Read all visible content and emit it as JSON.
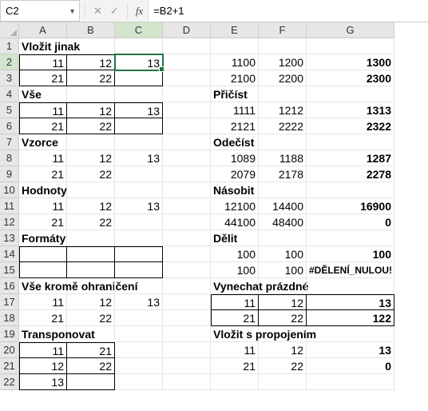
{
  "formula_bar": {
    "cell_ref": "C2",
    "formula": "=B2+1",
    "fx_label": "fx",
    "cancel_icon": "✕",
    "confirm_icon": "✓"
  },
  "columns": [
    "A",
    "B",
    "C",
    "D",
    "E",
    "F",
    "G"
  ],
  "rows": [
    "1",
    "2",
    "3",
    "4",
    "5",
    "6",
    "7",
    "8",
    "9",
    "10",
    "11",
    "12",
    "13",
    "14",
    "15",
    "16",
    "17",
    "18",
    "19",
    "20",
    "21",
    "22"
  ],
  "active_cell": "C2",
  "headers": {
    "r1_A": "Vložit jinak",
    "r4_A": "Vše",
    "r7_A": "Vzorce",
    "r10_A": "Hodnoty",
    "r13_A": "Formáty",
    "r16_A": "Vše kromě ohraničení",
    "r19_A": "Transponovat",
    "r4_E": "Přičíst",
    "r7_E": "Odečíst",
    "r10_E": "Násobit",
    "r13_E": "Dělit",
    "r16_E": "Vynechat prázdné",
    "r19_E": "Vložit s propojením"
  },
  "cells": {
    "A2": "11",
    "B2": "12",
    "C2": "13",
    "E2": "1100",
    "F2": "1200",
    "G2": "1300",
    "A3": "21",
    "B3": "22",
    "E3": "2100",
    "F3": "2200",
    "G3": "2300",
    "A5": "11",
    "B5": "12",
    "C5": "13",
    "E5": "1111",
    "F5": "1212",
    "G5": "1313",
    "A6": "21",
    "B6": "22",
    "E6": "2121",
    "F6": "2222",
    "G6": "2322",
    "A8": "11",
    "B8": "12",
    "C8": "13",
    "E8": "1089",
    "F8": "1188",
    "G8": "1287",
    "A9": "21",
    "B9": "22",
    "E9": "2079",
    "F9": "2178",
    "G9": "2278",
    "A11": "11",
    "B11": "12",
    "C11": "13",
    "E11": "12100",
    "F11": "14400",
    "G11": "16900",
    "A12": "21",
    "B12": "22",
    "E12": "44100",
    "F12": "48400",
    "G12": "0",
    "E14": "100",
    "F14": "100",
    "G14": "100",
    "E15": "100",
    "F15": "100",
    "G15": "#DĚLENÍ_NULOU!",
    "A17": "11",
    "B17": "12",
    "C17": "13",
    "E17": "11",
    "F17": "12",
    "G17": "13",
    "A18": "21",
    "B18": "22",
    "E18": "21",
    "F18": "22",
    "G18": "122",
    "A20": "11",
    "B20": "21",
    "E20": "11",
    "F20": "12",
    "G20": "13",
    "A21": "12",
    "B21": "22",
    "E21": "21",
    "F21": "22",
    "G21": "0",
    "A22": "13"
  }
}
